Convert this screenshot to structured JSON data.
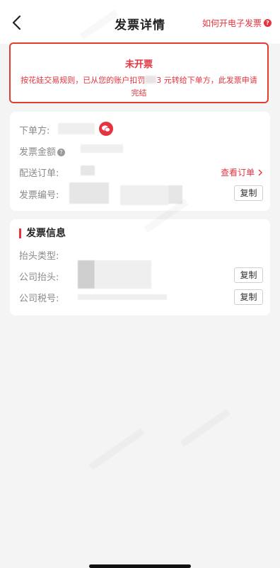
{
  "nav": {
    "title": "发票详情",
    "help_label": "如何开电子发票",
    "help_icon": "?"
  },
  "alert": {
    "status": "未开票",
    "desc_part1": "按花娃交易规则，已从您的账户扣罚",
    "desc_part2": "3 元转给下单方，此发票申请完结"
  },
  "order_card": {
    "buyer_label": "下单方:",
    "amount_label": "发票金额",
    "amount_info_icon": "?",
    "delivery_label": "配送订单:",
    "view_order_label": "查看订单",
    "invoice_no_label": "发票编号:",
    "copy_label": "复制"
  },
  "invoice_card": {
    "title": "发票信息",
    "header_type_label": "抬头类型:",
    "company_header_label": "公司抬头:",
    "tax_no_label": "公司税号:",
    "copy_label": "复制"
  },
  "colors": {
    "accent": "#e6333f",
    "alert_border": "#e33c30",
    "background": "#f4f4f4"
  }
}
